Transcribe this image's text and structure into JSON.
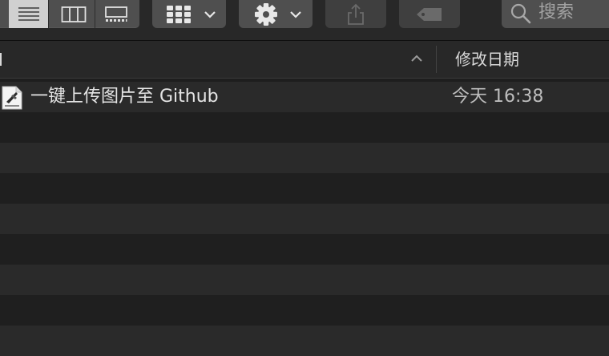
{
  "toolbar": {
    "view_buttons": [
      {
        "name": "list-view",
        "icon": "list-icon",
        "selected": true
      },
      {
        "name": "column-view",
        "icon": "columns-icon",
        "selected": false
      },
      {
        "name": "gallery-view",
        "icon": "gallery-icon",
        "selected": false
      }
    ],
    "group_button_icon": "grid-icon",
    "action_button_icon": "gear-icon",
    "share_button_icon": "share-icon",
    "tag_button_icon": "tag-icon",
    "search": {
      "placeholder": "搜索",
      "icon": "search-icon"
    }
  },
  "header": {
    "sort_icon": "chevron-up-icon",
    "date_column": "修改日期"
  },
  "files": [
    {
      "name": "一键上传图片至 Github",
      "modified": "今天 16:38",
      "icon": "alfred-workflow-icon"
    }
  ],
  "colors": {
    "window_bg": "#1e1e1e",
    "row_alt": "#2a2a2a",
    "toolbar_bg": "#282828",
    "button_bg": "#4f4f4f",
    "selected_segment": "#d0d0d0"
  }
}
